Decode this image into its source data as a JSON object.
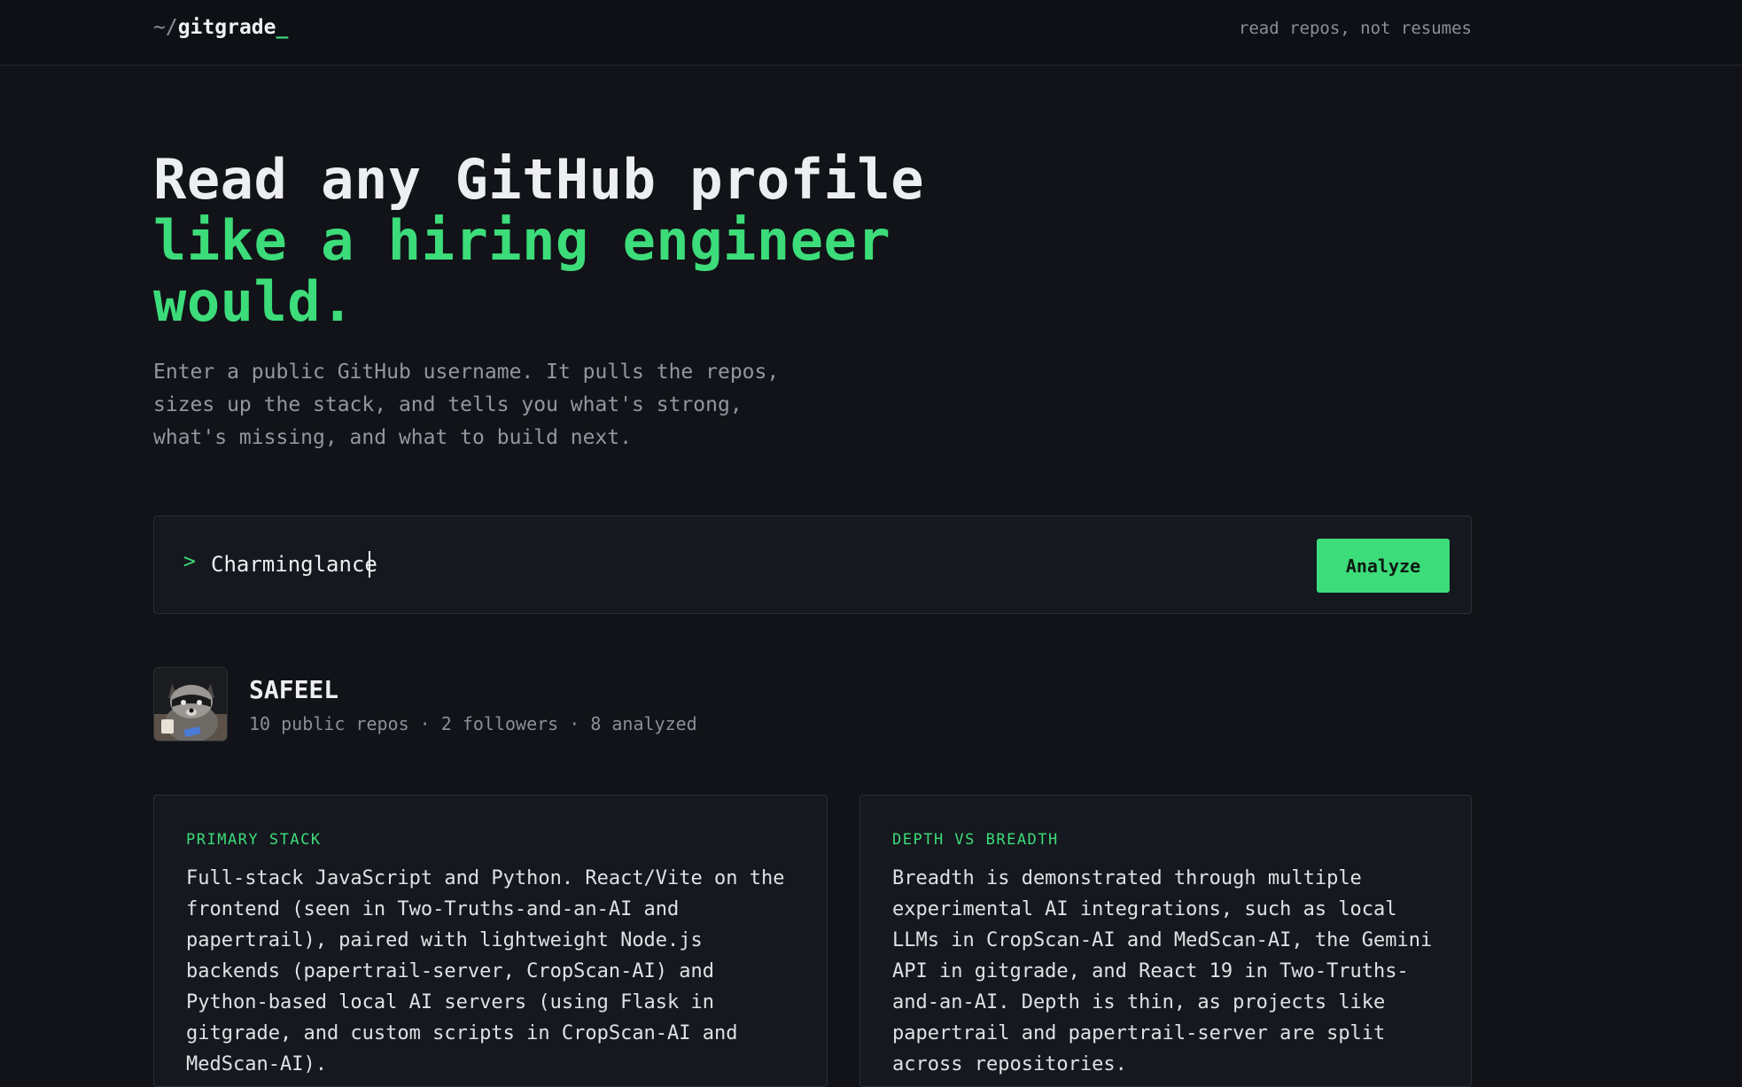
{
  "header": {
    "logo_prefix": "~/",
    "logo_name": "gitgrade",
    "logo_cursor": "_",
    "tagline": "read repos, not resumes"
  },
  "hero": {
    "title_line1": "Read any GitHub profile",
    "title_line2": "like a hiring engineer would.",
    "subtitle": "Enter a public GitHub username. It pulls the repos, sizes up the stack, and tells you what's strong, what's missing, and what to build next."
  },
  "search": {
    "prompt": ">",
    "value": "Charminglance",
    "button_label": "Analyze"
  },
  "profile": {
    "name": "SAFEEL",
    "meta": "10 public repos · 2 followers · 8 analyzed",
    "avatar_icon": "raccoon-avatar"
  },
  "cards": [
    {
      "label": "PRIMARY STACK",
      "body": "Full-stack JavaScript and Python. React/Vite on the frontend (seen in Two-Truths-and-an-AI and papertrail), paired with lightweight Node.js backends (papertrail-server, CropScan-AI) and Python-based local AI servers (using Flask in gitgrade, and custom scripts in CropScan-AI and MedScan-AI)."
    },
    {
      "label": "DEPTH VS BREADTH",
      "body": "Breadth is demonstrated through multiple experimental AI integrations, such as local LLMs in CropScan-AI and MedScan-AI, the Gemini API in gitgrade, and React 19 in Two-Truths-and-an-AI. Depth is thin, as projects like papertrail and papertrail-server are split across repositories."
    }
  ],
  "colors": {
    "accent": "#3ddc7a",
    "background": "#111318",
    "panel": "#15181e"
  }
}
